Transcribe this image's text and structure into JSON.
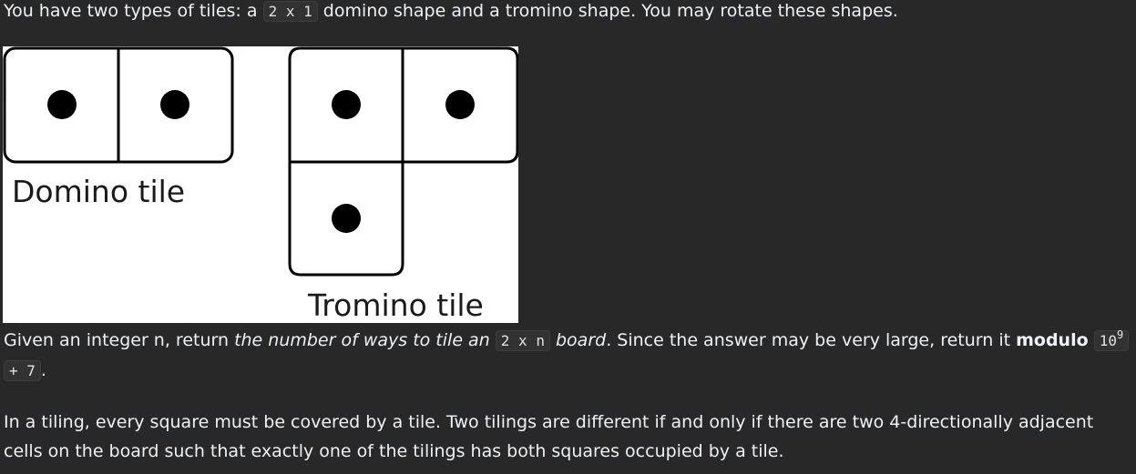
{
  "intro": {
    "prefix": "You have two types of tiles: a ",
    "code": "2 x 1",
    "suffix": " domino shape and a tromino shape. You may rotate these shapes."
  },
  "figure": {
    "domino_label": "Domino tile",
    "tromino_label": "Tromino tile"
  },
  "para2": {
    "part1": "Given an integer n, return ",
    "italic1": "the number of ways to tile an ",
    "code": "2 x n",
    "italic2": " board",
    "part2": ". Since the answer may be very large, return it ",
    "bold": "modulo",
    "mod_base": "10",
    "mod_exp": "9",
    "mod_tail": "+ 7",
    "end": "."
  },
  "para3": {
    "line1": "In a tiling, every square must be covered by a tile. Two tilings are different if and only if there are two 4-directionally adjacent",
    "line2": "cells on the board such that exactly one of the tilings has both squares occupied by a tile."
  }
}
